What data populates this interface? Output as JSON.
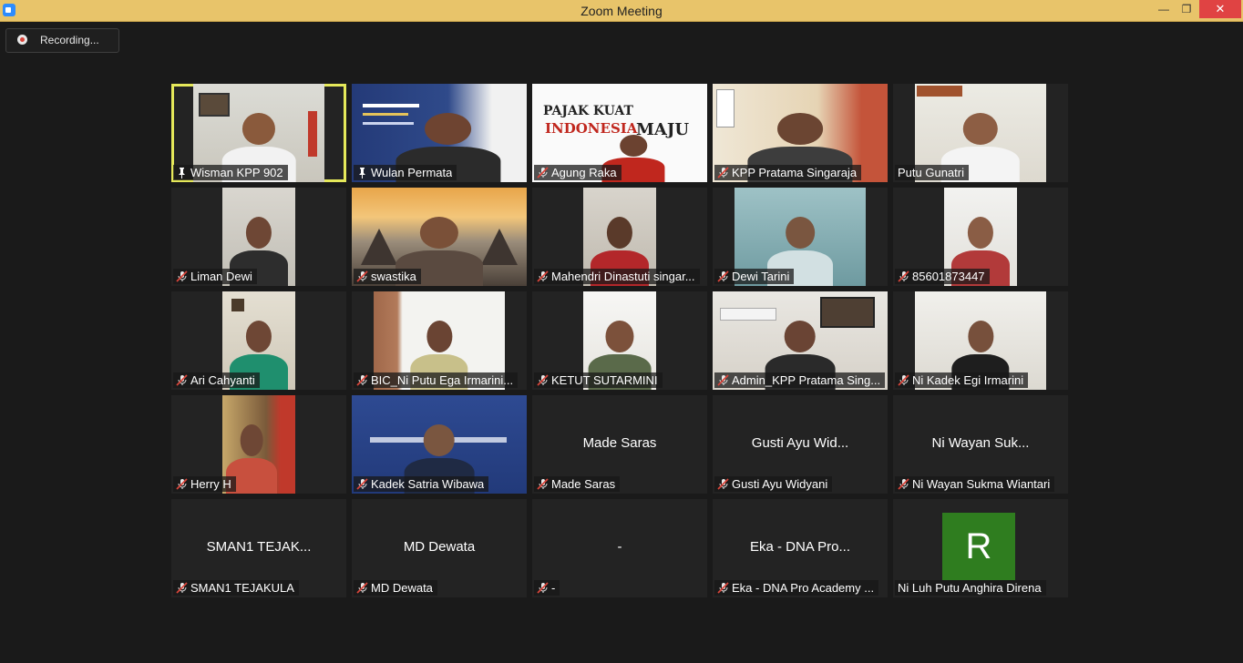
{
  "window": {
    "title": "Zoom Meeting",
    "minimize_glyph": "—",
    "maximize_glyph": "❐",
    "close_glyph": "✕"
  },
  "recording": {
    "label": "Recording..."
  },
  "colors": {
    "active_speaker_border": "#e5e85a",
    "muted_mic": "#d9443a",
    "avatar_bg": "#2f7d1f"
  },
  "poster": {
    "pajak_line1": "PAJAK KUAT",
    "pajak_line2": "INDONESIA",
    "pajak_line3": "MAJU"
  },
  "participants": [
    {
      "name": "Wisman KPP 902",
      "icon": "pin-icon",
      "video": true
    },
    {
      "name": "Wulan Permata",
      "icon": "pin-icon",
      "video": true
    },
    {
      "name": "Agung Raka",
      "icon": "mic-muted-icon",
      "video": true
    },
    {
      "name": "KPP Pratama Singaraja",
      "icon": "mic-muted-icon",
      "video": true
    },
    {
      "name": "Putu Gunatri",
      "icon": "none",
      "video": true
    },
    {
      "name": "Liman Dewi",
      "icon": "mic-muted-icon",
      "video": true
    },
    {
      "name": "swastika",
      "icon": "mic-muted-icon",
      "video": true
    },
    {
      "name": "Mahendri Dinastuti singar...",
      "icon": "mic-muted-icon",
      "video": true
    },
    {
      "name": "Dewi Tarini",
      "icon": "mic-muted-icon",
      "video": true
    },
    {
      "name": "85601873447",
      "icon": "mic-muted-icon",
      "video": true
    },
    {
      "name": "Ari Cahyanti",
      "icon": "mic-muted-icon",
      "video": true
    },
    {
      "name": "BIC_Ni Putu Ega Irmarini...",
      "icon": "mic-muted-icon",
      "video": true
    },
    {
      "name": "KETUT SUTARMINI",
      "icon": "mic-muted-icon",
      "video": true
    },
    {
      "name": "Admin_KPP Pratama Sing...",
      "icon": "mic-muted-icon",
      "video": true
    },
    {
      "name": "Ni Kadek Egi Irmarini",
      "icon": "mic-muted-icon",
      "video": true
    },
    {
      "name": "Herry H",
      "icon": "mic-muted-icon",
      "video": true
    },
    {
      "name": "Kadek Satria Wibawa",
      "icon": "mic-muted-icon",
      "video": true
    },
    {
      "name": "Made Saras",
      "icon": "mic-muted-icon",
      "video": false,
      "center": "Made Saras"
    },
    {
      "name": "Gusti Ayu Widyani",
      "icon": "mic-muted-icon",
      "video": false,
      "center": "Gusti Ayu Wid..."
    },
    {
      "name": "Ni Wayan Sukma Wiantari",
      "icon": "mic-muted-icon",
      "video": false,
      "center": "Ni Wayan Suk..."
    },
    {
      "name": "SMAN1 TEJAKULA",
      "icon": "mic-muted-icon",
      "video": false,
      "center": "SMAN1 TEJAK..."
    },
    {
      "name": "MD Dewata",
      "icon": "mic-muted-icon",
      "video": false,
      "center": "MD Dewata"
    },
    {
      "name": "-",
      "icon": "mic-muted-icon",
      "video": false,
      "center": "-"
    },
    {
      "name": "Eka - DNA Pro Academy ...",
      "icon": "mic-muted-icon",
      "video": false,
      "center": "Eka - DNA Pro..."
    },
    {
      "name": "Ni Luh Putu Anghira Direna",
      "icon": "none",
      "video": false,
      "avatar": "R"
    }
  ]
}
